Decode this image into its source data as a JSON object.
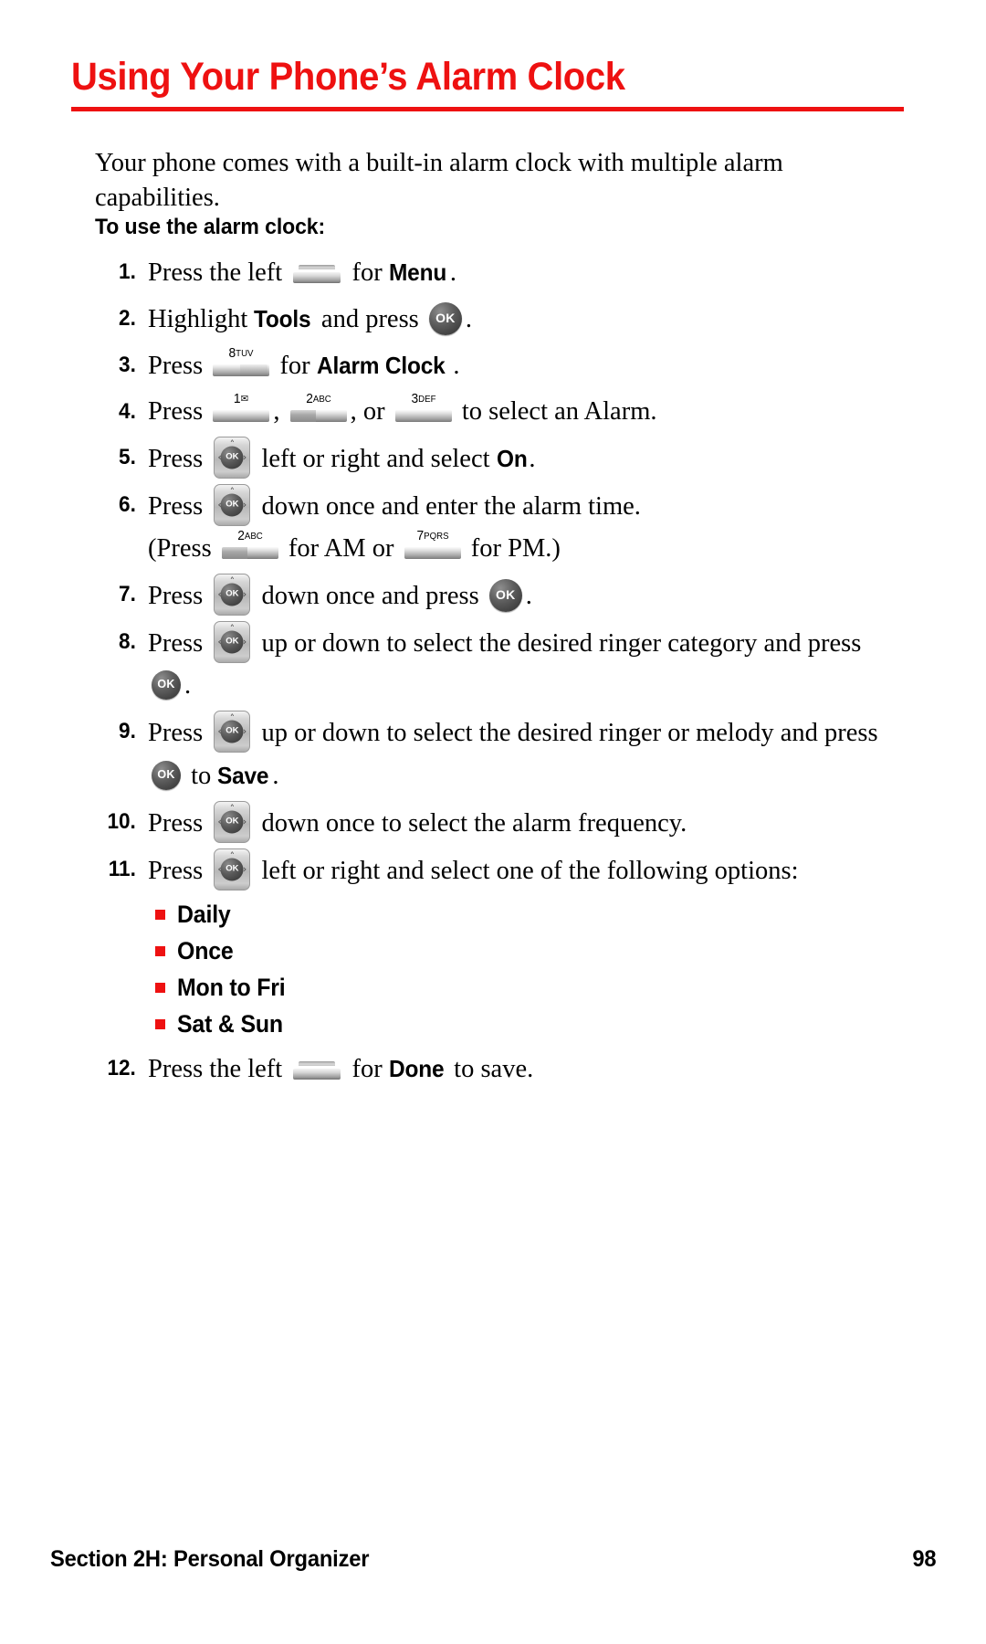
{
  "title": "Using Your Phone’s Alarm Clock",
  "accent_color": "#ee1111",
  "intro": "Your phone comes with a built-in alarm clock with multiple alarm capabilities.",
  "subhead": "To use the alarm clock:",
  "steps": [
    {
      "num": "1.",
      "t1": "Press the left ",
      "t2": " for ",
      "ui": "Menu",
      "t3": "."
    },
    {
      "num": "2.",
      "t1": "Highlight ",
      "ui": "Tools",
      "t2": " and press ",
      "t3": "."
    },
    {
      "num": "3.",
      "t1": "Press ",
      "t2": " for ",
      "ui": "Alarm Clock",
      "t3": "."
    },
    {
      "num": "4.",
      "t1": "Press ",
      "t2": ", ",
      "t3": ", or ",
      "t4": " to select an Alarm."
    },
    {
      "num": "5.",
      "t1": "Press ",
      "t2": " left or right and select ",
      "ui": "On",
      "t3": "."
    },
    {
      "num": "6.",
      "t1": "Press ",
      "t2": " down once and enter the alarm time.",
      "l2a": "(Press ",
      "l2b": " for AM or ",
      "l2c": " for PM.)"
    },
    {
      "num": "7.",
      "t1": "Press ",
      "t2": " down once and press ",
      "t3": "."
    },
    {
      "num": "8.",
      "t1": "Press ",
      "t2": " up or down to select the desired ringer category and press ",
      "t3": "."
    },
    {
      "num": "9.",
      "t1": "Press ",
      "t2": " up or down to select the desired ringer or melody and press ",
      "t3": " to ",
      "ui": "Save",
      "t4": "."
    },
    {
      "num": "10.",
      "t1": "Press ",
      "t2": " down once to select the alarm frequency."
    },
    {
      "num": "11.",
      "t1": "Press ",
      "t2": " left or right and select one of the following options:"
    },
    {
      "num": "12.",
      "t1": "Press the left ",
      "t2": " for ",
      "ui": "Done",
      "t3": " to save."
    }
  ],
  "options": [
    {
      "label": "Daily"
    },
    {
      "label": "Once"
    },
    {
      "label": "Mon to Fri"
    },
    {
      "label": "Sat & Sun"
    }
  ],
  "keys": {
    "ok_label": "OK",
    "nav_ok_label": "OK",
    "nav_up": "˄",
    "nav_down": "˅",
    "nav_left": "‹",
    "nav_right": "›",
    "k1_digit": "1",
    "k1_letters": "✉",
    "k2_digit": "2",
    "k2_letters": "ABC",
    "k3_digit": "3",
    "k3_letters": "DEF",
    "k7_digit": "7",
    "k7_letters": "PQRS",
    "k8_digit": "8",
    "k8_letters": "TUV"
  },
  "footer": {
    "section": "Section 2H: Personal Organizer",
    "page": "98"
  }
}
